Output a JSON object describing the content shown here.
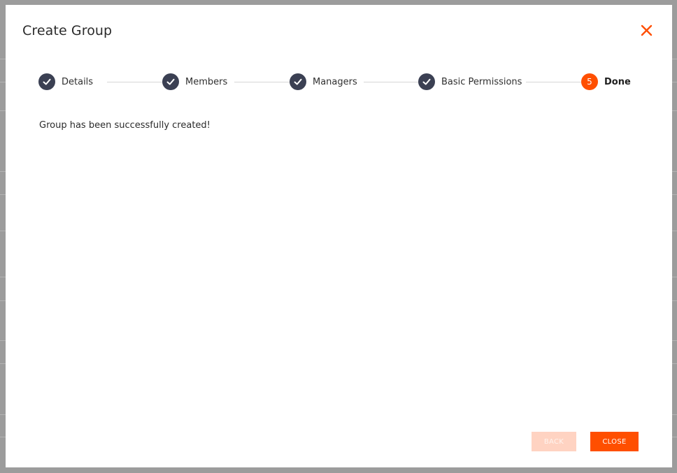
{
  "dialog": {
    "title": "Create Group",
    "close_icon": "close-icon"
  },
  "stepper": {
    "steps": [
      {
        "label": "Details",
        "state": "completed",
        "icon": "checkmark-icon"
      },
      {
        "label": "Members",
        "state": "completed",
        "icon": "checkmark-icon"
      },
      {
        "label": "Managers",
        "state": "completed",
        "icon": "checkmark-icon"
      },
      {
        "label": "Basic Permissions",
        "state": "completed",
        "icon": "checkmark-icon"
      },
      {
        "label": "Done",
        "state": "current",
        "number": "5"
      }
    ]
  },
  "content": {
    "message": "Group has been successfully created!"
  },
  "footer": {
    "back_label": "BACK",
    "back_disabled": true,
    "close_label": "CLOSE"
  },
  "colors": {
    "accent": "#ff4f00",
    "completed_step": "#3b4053",
    "back_disabled": "#ffd3c2"
  }
}
